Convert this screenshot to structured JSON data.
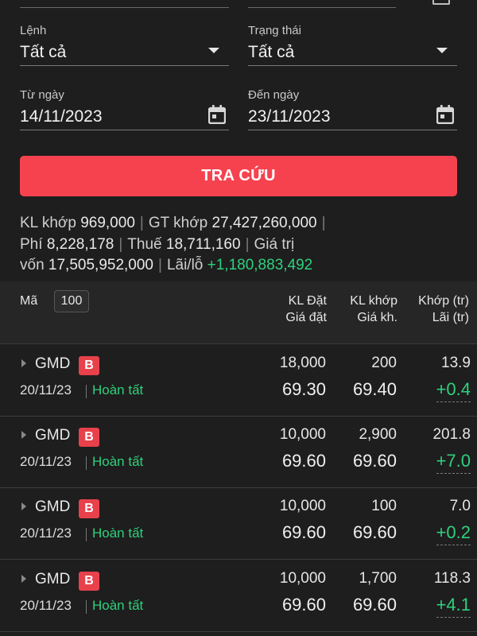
{
  "filters": {
    "order_label": "Lệnh",
    "order_value": "Tất cả",
    "status_label": "Trạng thái",
    "status_value": "Tất cả",
    "from_label": "Từ ngày",
    "from_value": "14/11/2023",
    "to_label": "Đến ngày",
    "to_value": "23/11/2023"
  },
  "search_button": "TRA CỨU",
  "summary": {
    "kl_label": "KL khớp",
    "kl_value": "969,000",
    "gt_label": "GT khớp",
    "gt_value": "27,427,260,000",
    "fee_label": "Phí",
    "fee_value": "8,228,178",
    "tax_label": "Thuế",
    "tax_value": "18,711,160",
    "capital_label_1": "Giá trị",
    "capital_label_2": "vốn",
    "capital_value": "17,505,952,000",
    "pl_label": "Lãi/lỗ",
    "pl_value": "+1,180,883,492"
  },
  "table": {
    "header": {
      "symbol": "Mã",
      "page_size": "100",
      "col1_top": "KL Đặt",
      "col1_bottom": "Giá đặt",
      "col2_top": "KL khớp",
      "col2_bottom": "Giá kh.",
      "col3_top": "Khớp (tr)",
      "col3_bottom": "Lãi (tr)"
    },
    "rows": [
      {
        "symbol": "GMD",
        "side": "B",
        "date": "20/11/23",
        "status": "Hoàn tất",
        "order_qty": "18,000",
        "order_price": "69.30",
        "match_qty": "200",
        "match_price": "69.40",
        "match_value": "13.9",
        "profit": "+0.4"
      },
      {
        "symbol": "GMD",
        "side": "B",
        "date": "20/11/23",
        "status": "Hoàn tất",
        "order_qty": "10,000",
        "order_price": "69.60",
        "match_qty": "2,900",
        "match_price": "69.60",
        "match_value": "201.8",
        "profit": "+7.0"
      },
      {
        "symbol": "GMD",
        "side": "B",
        "date": "20/11/23",
        "status": "Hoàn tất",
        "order_qty": "10,000",
        "order_price": "69.60",
        "match_qty": "100",
        "match_price": "69.60",
        "match_value": "7.0",
        "profit": "+0.2"
      },
      {
        "symbol": "GMD",
        "side": "B",
        "date": "20/11/23",
        "status": "Hoàn tất",
        "order_qty": "10,000",
        "order_price": "69.60",
        "match_qty": "1,700",
        "match_price": "69.60",
        "match_value": "118.3",
        "profit": "+4.1"
      }
    ]
  },
  "icons": {
    "dropdown": "caret-down-icon",
    "calendar": "calendar-icon",
    "expand": "triangle-right-icon"
  },
  "colors": {
    "accent": "#f6424f",
    "positive": "#2fd07d",
    "background": "#1e1e1e"
  }
}
